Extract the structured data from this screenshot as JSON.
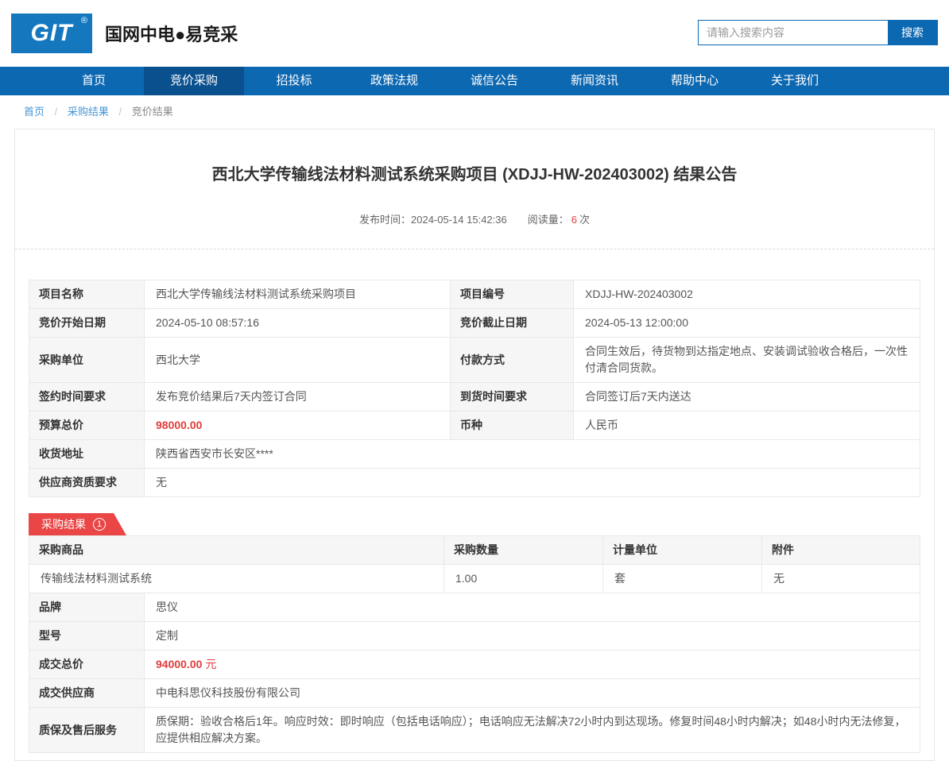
{
  "colors": {
    "nav_blue": "#0d68b2",
    "nav_active_blue": "#0a508f",
    "logo_blue": "#1578bf",
    "badge_red": "#ea4646",
    "price_red": "#e33b3b",
    "link_blue": "#4696d2"
  },
  "header": {
    "logo_text": "GIT",
    "logo_reg": "®",
    "site_name": "国网中电●易竞采",
    "search_placeholder": "请输入搜索内容",
    "search_button": "搜索"
  },
  "nav": {
    "items": [
      {
        "label": "首页"
      },
      {
        "label": "竞价采购",
        "active": true
      },
      {
        "label": "招投标"
      },
      {
        "label": "政策法规"
      },
      {
        "label": "诚信公告"
      },
      {
        "label": "新闻资讯"
      },
      {
        "label": "帮助中心"
      },
      {
        "label": "关于我们"
      }
    ]
  },
  "breadcrumb": {
    "separator": "/",
    "items": [
      "首页",
      "采购结果",
      "竞价结果"
    ]
  },
  "article": {
    "title": "西北大学传输线法材料测试系统采购项目 (XDJJ-HW-202403002) 结果公告",
    "publish_label": "发布时间：",
    "publish_time": "2024-05-14 15:42:36",
    "views_label": "阅读量：",
    "views_count": "6",
    "views_unit": "次"
  },
  "project": {
    "rows": [
      {
        "label1": "项目名称",
        "value1": "西北大学传输线法材料测试系统采购项目",
        "label2": "项目编号",
        "value2": "XDJJ-HW-202403002"
      },
      {
        "label1": "竞价开始日期",
        "value1": "2024-05-10 08:57:16",
        "label2": "竞价截止日期",
        "value2": "2024-05-13 12:00:00"
      },
      {
        "label1": "采购单位",
        "value1": "西北大学",
        "label2": "付款方式",
        "value2": "合同生效后，待货物到达指定地点、安装调试验收合格后，一次性付清合同货款。"
      },
      {
        "label1": "签约时间要求",
        "value1": "发布竞价结果后7天内签订合同",
        "label2": "到货时间要求",
        "value2": "合同签订后7天内送达"
      },
      {
        "label1": "预算总价",
        "value1": "98000.00",
        "label2": "币种",
        "value2": "人民币"
      },
      {
        "label1": "收货地址",
        "value1": "陕西省西安市长安区****"
      },
      {
        "label1": "供应商资质要求",
        "value1": "无"
      }
    ]
  },
  "result": {
    "badge_label": "采购结果",
    "badge_count": "1",
    "product_header": [
      "采购商品",
      "采购数量",
      "计量单位",
      "附件"
    ],
    "product_row": [
      "传输线法材料测试系统",
      "1.00",
      "套",
      "无"
    ],
    "details": [
      {
        "label": "品牌",
        "value": "思仪"
      },
      {
        "label": "型号",
        "value": "定制"
      },
      {
        "label": "成交供应商",
        "value": "中电科思仪科技股份有限公司"
      },
      {
        "label": "质保及售后服务",
        "value": "质保期：验收合格后1年。响应时效：即时响应（包括电话响应）；电话响应无法解决72小时内到达现场。修复时间48小时内解决；如48小时内无法修复，应提供相应解决方案。"
      }
    ],
    "deal_price": {
      "label": "成交总价",
      "amount": "94000.00",
      "unit": "元"
    }
  }
}
